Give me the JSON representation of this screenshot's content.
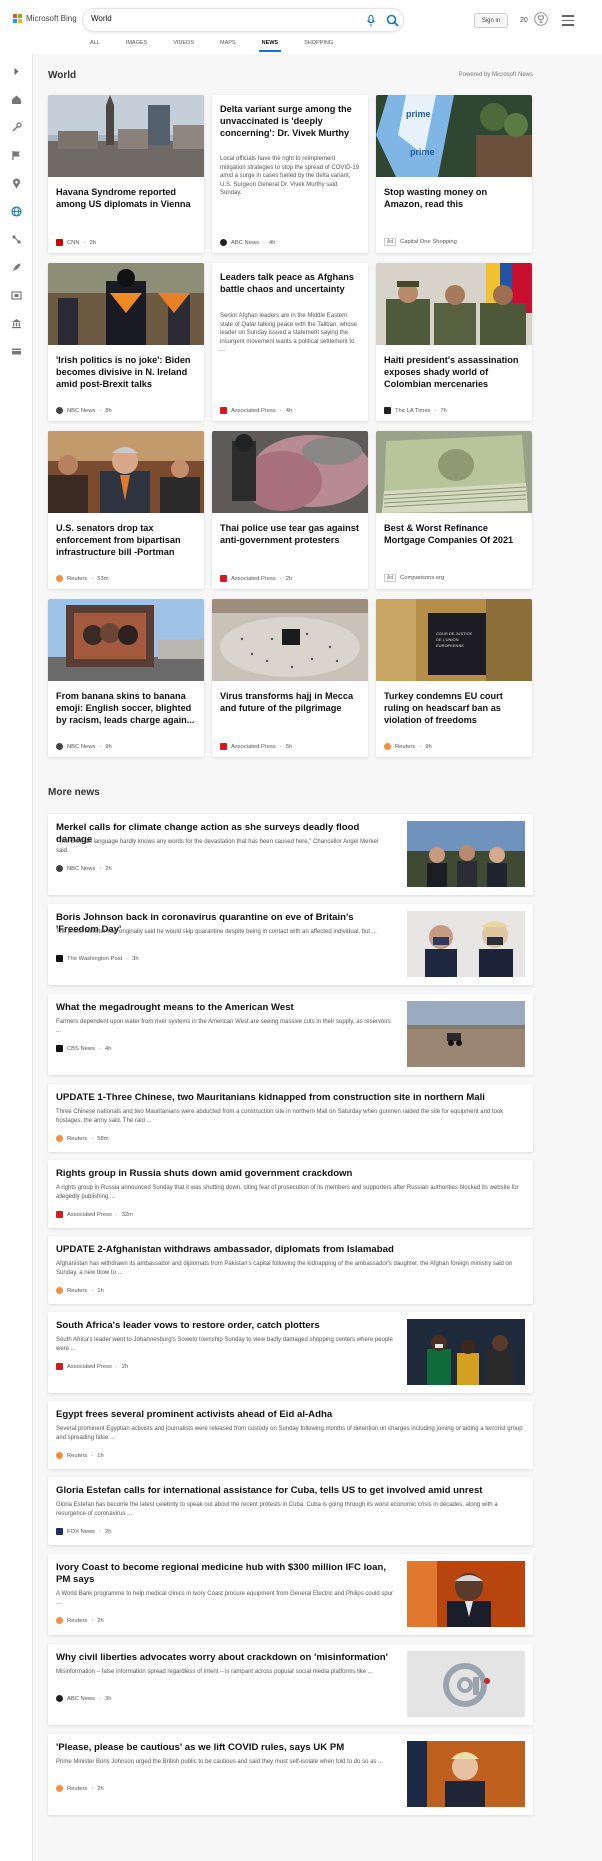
{
  "header": {
    "logo_text": "Microsoft Bing",
    "search_value": "World",
    "signin_label": "Sign in",
    "rewards_count": "20",
    "scopes": [
      {
        "label": "ALL"
      },
      {
        "label": "IMAGES"
      },
      {
        "label": "VIDEOS"
      },
      {
        "label": "MAPS"
      },
      {
        "label": "NEWS"
      },
      {
        "label": "SHOPPING"
      }
    ],
    "active_scope": "NEWS"
  },
  "rail": {
    "icons": [
      "expand-icon",
      "home-icon",
      "tools-icon",
      "flag-icon",
      "location-icon",
      "globe-icon",
      "science-icon",
      "rocket-icon",
      "film-icon",
      "bank-icon",
      "money-icon"
    ]
  },
  "section": {
    "title": "World",
    "powered_by": "Powered by Microsoft News"
  },
  "cards": [
    {
      "title": "Havana Syndrome reported among US diplomats in Vienna",
      "source": "CNN",
      "time": "3h",
      "ad": false
    },
    {
      "title": "Delta variant surge among the unvaccinated is 'deeply concerning': Dr. Vivek Murthy",
      "snippet": "Local officials have the right to reimplement mitigation strategies to stop the spread of COVID-19 amid a surge in cases fueled by the delta variant, U.S. Surgeon General Dr. Vivek Murthy said Sunday.",
      "source": "ABC News",
      "time": "4h",
      "ad": false
    },
    {
      "title": "Stop wasting money on Amazon, read this",
      "source": "Capital One Shopping",
      "ad_label": "Ad",
      "ad": true
    },
    {
      "title": "'Irish politics is no joke': Biden becomes divisive in N. Ireland amid post-Brexit talks",
      "source": "NBC News",
      "time": "8h",
      "ad": false
    },
    {
      "title": "Leaders talk peace as Afghans battle chaos and uncertainty",
      "snippet": "Senior Afghan leaders are in the Middle Eastern state of Qatar talking peace with the Taliban, whose leader on Sunday issued a statement saying the insurgent movement wants a political settlement to ...",
      "source": "Associated Press",
      "time": "4h",
      "ad": false
    },
    {
      "title": "Haiti president's assassination exposes shady world of Colombian mercenaries",
      "source": "The LA Times",
      "time": "7h",
      "ad": false
    },
    {
      "title": "U.S. senators drop tax enforcement from bipartisan infrastructure bill -Portman",
      "source": "Reuters",
      "time": "53m",
      "ad": false
    },
    {
      "title": "Thai police use tear gas against anti-government protesters",
      "source": "Associated Press",
      "time": "2h",
      "ad": false
    },
    {
      "title": "Best & Worst Refinance Mortgage Companies Of 2021",
      "source": "Comparisons.org",
      "ad_label": "Ad",
      "ad": true
    },
    {
      "title": "From banana skins to banana emoji: English soccer, blighted by racism, leads charge again...",
      "source": "NBC News",
      "time": "9h",
      "ad": false
    },
    {
      "title": "Virus transforms hajj in Mecca and future of the pilgrimage",
      "source": "Associated Press",
      "time": "5h",
      "ad": false
    },
    {
      "title": "Turkey condemns EU court ruling on headscarf ban as violation of freedoms",
      "source": "Reuters",
      "time": "9h",
      "ad": false
    }
  ],
  "more_news": {
    "title": "More news",
    "items": [
      {
        "title": "Merkel calls for climate change action as she surveys deadly flood damage",
        "snippet": "\"The German language hardly knows any words for the devastation that has been caused here,\" Chancellor Angel Merkel said.",
        "source": "NBC News",
        "time": "2h",
        "thumb": true
      },
      {
        "title": "Boris Johnson back in coronavirus quarantine on eve of Britain's 'Freedom Day'",
        "snippet": "The prime minister had originally said he would skip quarantine despite being in contact with an affected individual, but ...",
        "source": "The Washington Post",
        "time": "3h",
        "thumb": true
      },
      {
        "title": "What the megadrought means to the American West",
        "snippet": "Farmers dependent upon water from river systems in the American West are seeing massive cuts in their supply, as reservoirs ...",
        "source": "CBS News",
        "time": "4h",
        "thumb": true
      },
      {
        "title": "UPDATE 1-Three Chinese, two Mauritanians kidnapped from construction site in northern Mali",
        "snippet": "Three Chinese nationals and two Mauritanians were abducted from a construction site in northern Mali on Saturday when gunmen raided the site for equipment and took hostages, the army said. The raid ...",
        "source": "Reuters",
        "time": "58m",
        "thumb": false
      },
      {
        "title": "Rights group in Russia shuts down amid government crackdown",
        "snippet": "A rights group in Russia announced Sunday that it was shutting down, citing fear of prosecution of its members and supporters after Russian authorities blocked its website for allegedly publishing ...",
        "source": "Associated Press",
        "time": "32m",
        "thumb": false
      },
      {
        "title": "UPDATE 2-Afghanistan withdraws ambassador, diplomats from Islamabad",
        "snippet": "Afghanistan has withdrawn its ambassador and diplomats from Pakistan's capital following the kidnapping of the ambassador's daughter, the Afghan foreign ministry said on Sunday, a new blow to ...",
        "source": "Reuters",
        "time": "1h",
        "thumb": false
      },
      {
        "title": "South Africa's leader vows to restore order, catch plotters",
        "snippet": "South Africa's leader went to Johannesburg's Soweto township Sunday to view badly damaged shopping centers where people were ...",
        "source": "Associated Press",
        "time": "2h",
        "thumb": true
      },
      {
        "title": "Egypt frees several prominent activists ahead of Eid al-Adha",
        "snippet": "Several prominent Egyptian activists and journalists were released from custody on Sunday following months of detention on charges including joining or aiding a terrorist group and spreading false ...",
        "source": "Reuters",
        "time": "1h",
        "thumb": false
      },
      {
        "title": "Gloria Estefan calls for international assistance for Cuba, tells US to get involved amid unrest",
        "snippet": "Gloria Estefan has become the latest celebrity to speak out about the recent protests in Cuba.  Cuba is going through its worst economic crisis in decades, along with a resurgence of coronavirus ...",
        "source": "FOX News",
        "time": "2h",
        "thumb": false
      },
      {
        "title": "Ivory Coast to become regional medicine hub with $300 million IFC loan, PM says",
        "snippet": "A World Bank programme to help medical clinics in Ivory Coast procure equipment from General Electric and Philips could spur ...",
        "source": "Reuters",
        "time": "2h",
        "thumb": true
      },
      {
        "title": "Why civil liberties advocates worry about crackdown on 'misinformation'",
        "snippet": "Misinformation – false information spread regardless of intent – is rampant across popular social media platforms like ...",
        "source": "ABC News",
        "time": "3h",
        "thumb": true
      },
      {
        "title": "'Please, please be cautious' as we lift COVID rules, says UK PM",
        "snippet": "Prime Minister Boris Johnson urged the British public to be cautious and said they must self-isolate when told to do so as ...",
        "source": "Reuters",
        "time": "2h",
        "thumb": true
      }
    ]
  },
  "colors": {
    "accent": "#1a73c7",
    "cnn": "#cc0000",
    "reuters": "#f68f3d",
    "ap": "#d71920"
  }
}
